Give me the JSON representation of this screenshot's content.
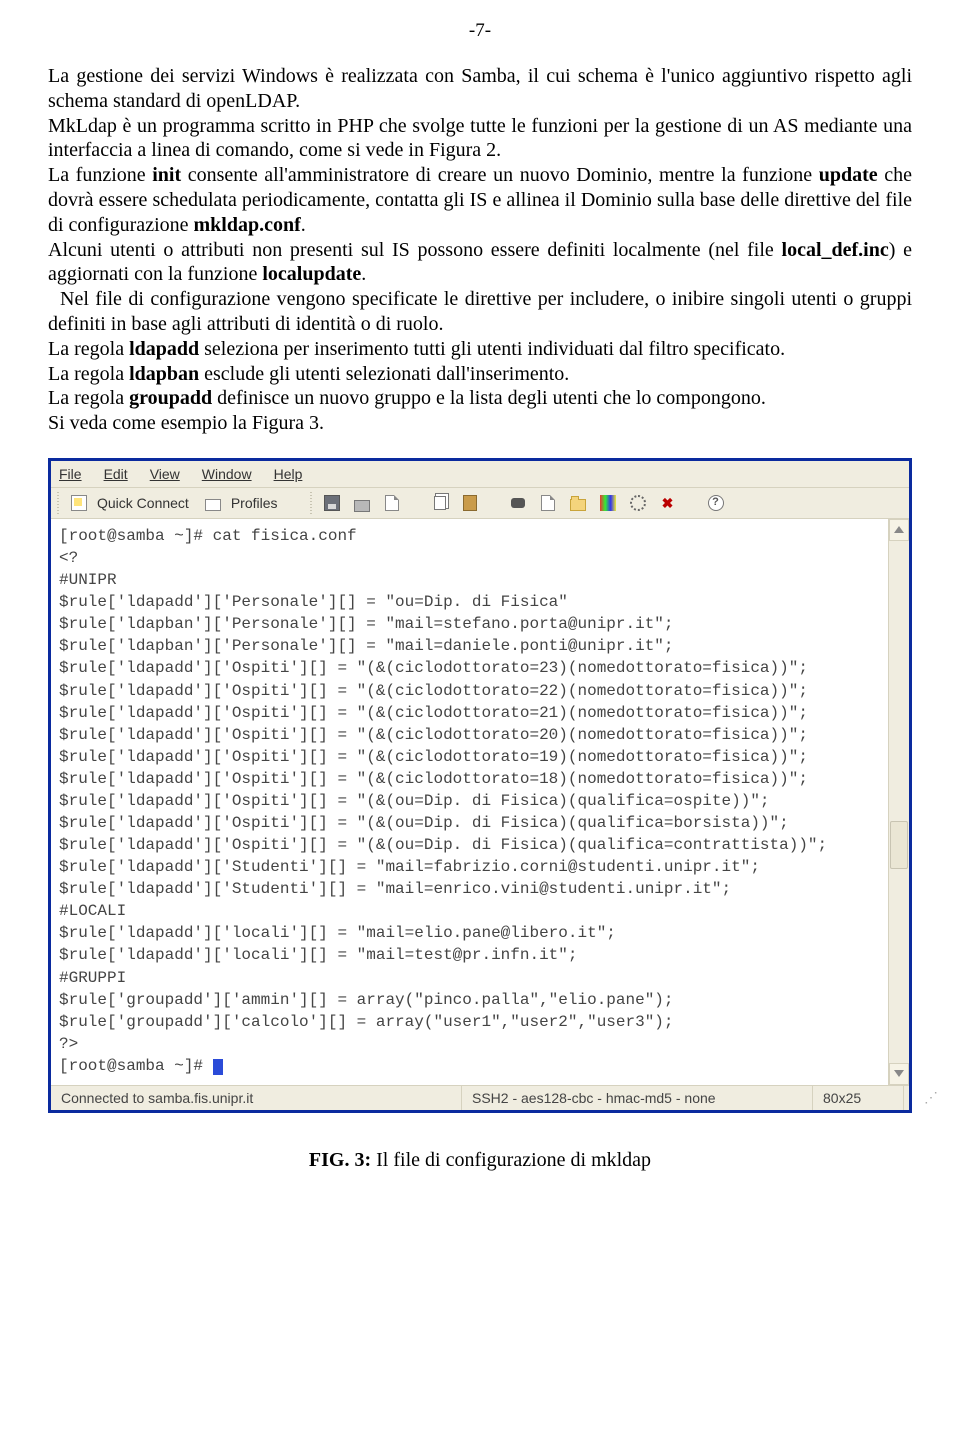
{
  "page_number": "-7-",
  "paragraphs": {
    "p1a": "La gestione dei servizi Windows è realizzata con  Samba, il cui schema è l'unico aggiuntivo rispetto agli schema standard di  openLDAP.",
    "p1b": "MkLdap è un programma scritto in PHP che svolge tutte le funzioni per la gestione di un AS mediante una interfaccia a linea di comando, come si vede in Figura 2.",
    "p2_pre": "La funzione ",
    "p2_b1": "init",
    "p2_mid1": "  consente all'amministratore di creare un nuovo Dominio, mentre la funzione ",
    "p2_b2": "update",
    "p2_mid2": " che dovrà essere schedulata periodicamente, contatta gli IS e allinea il Dominio sulla base delle direttive del file di configurazione ",
    "p2_b3": "mkldap.conf",
    "p2_end": ".",
    "p3_pre": "Alcuni utenti o attributi non presenti sul IS possono essere definiti localmente (nel file ",
    "p3_b1": "local_def.inc",
    "p3_mid": ")  e aggiornati con la funzione  ",
    "p3_b2": "localupdate",
    "p3_end": ".",
    "p4": " Nel file di configurazione vengono specificate le direttive per includere, o inibire singoli utenti o gruppi definiti in base agli attributi di  identità o di ruolo.",
    "p5_pre": "La regola ",
    "p5_b": "ldapadd",
    "p5_end": " seleziona per inserimento tutti gli utenti individuati dal filtro specificato.",
    "p6_pre": "La regola ",
    "p6_b": "ldapban",
    "p6_end": " esclude gli utenti selezionati dall'inserimento.",
    "p7_pre": "La regola ",
    "p7_b": "groupadd",
    "p7_end": " definisce un nuovo gruppo e la lista degli  utenti che lo compongono.",
    "p8": "Si veda come esempio la Figura 3."
  },
  "menu": {
    "file": "File",
    "edit": "Edit",
    "view": "View",
    "window": "Window",
    "help": "Help"
  },
  "toolbar": {
    "quick_connect": "Quick Connect",
    "profiles": "Profiles"
  },
  "terminal_lines": [
    "[root@samba ~]# cat fisica.conf",
    "<?",
    "#UNIPR",
    "$rule['ldapadd']['Personale'][] = \"ou=Dip. di Fisica\"",
    "$rule['ldapban']['Personale'][] = \"mail=stefano.porta@unipr.it\";",
    "$rule['ldapban']['Personale'][] = \"mail=daniele.ponti@unipr.it\";",
    "$rule['ldapadd']['Ospiti'][] = \"(&(ciclodottorato=23)(nomedottorato=fisica))\";",
    "$rule['ldapadd']['Ospiti'][] = \"(&(ciclodottorato=22)(nomedottorato=fisica))\";",
    "$rule['ldapadd']['Ospiti'][] = \"(&(ciclodottorato=21)(nomedottorato=fisica))\";",
    "$rule['ldapadd']['Ospiti'][] = \"(&(ciclodottorato=20)(nomedottorato=fisica))\";",
    "$rule['ldapadd']['Ospiti'][] = \"(&(ciclodottorato=19)(nomedottorato=fisica))\";",
    "$rule['ldapadd']['Ospiti'][] = \"(&(ciclodottorato=18)(nomedottorato=fisica))\";",
    "$rule['ldapadd']['Ospiti'][] = \"(&(ou=Dip. di Fisica)(qualifica=ospite))\";",
    "$rule['ldapadd']['Ospiti'][] = \"(&(ou=Dip. di Fisica)(qualifica=borsista))\";",
    "$rule['ldapadd']['Ospiti'][] = \"(&(ou=Dip. di Fisica)(qualifica=contrattista))\";",
    "$rule['ldapadd']['Studenti'][] = \"mail=fabrizio.corni@studenti.unipr.it\";",
    "$rule['ldapadd']['Studenti'][] = \"mail=enrico.vini@studenti.unipr.it\";",
    "#LOCALI",
    "$rule['ldapadd']['locali'][] = \"mail=elio.pane@libero.it\";",
    "$rule['ldapadd']['locali'][] = \"mail=test@pr.infn.it\";",
    "#GRUPPI",
    "$rule['groupadd']['ammin'][] = array(\"pinco.palla\",\"elio.pane\");",
    "$rule['groupadd']['calcolo'][] = array(\"user1\",\"user2\",\"user3\");",
    "?>",
    "[root@samba ~]# "
  ],
  "status": {
    "host": "Connected to samba.fis.unipr.it",
    "cipher": "SSH2 - aes128-cbc - hmac-md5 - none",
    "size": "80x25"
  },
  "caption": {
    "bold": "FIG. 3:",
    "rest": " Il file di configurazione di mkldap"
  }
}
